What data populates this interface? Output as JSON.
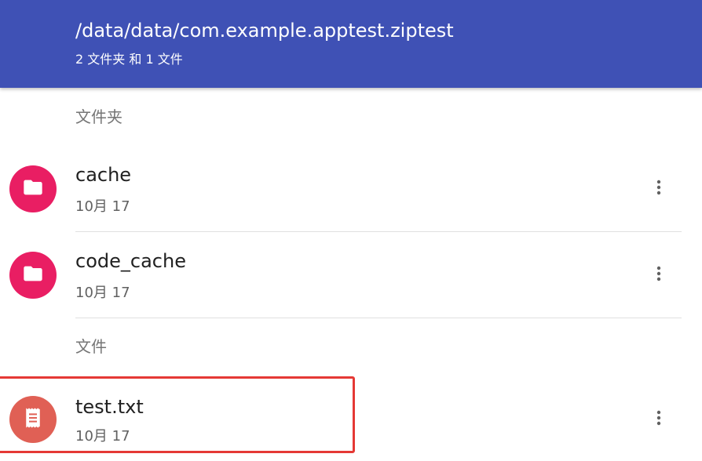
{
  "appbar": {
    "title": "/data/data/com.example.apptest.ziptest",
    "subtitle": "2 文件夹 和 1 文件",
    "color": "#3f51b5"
  },
  "sections": {
    "folders_header": "文件夹",
    "files_header": "文件"
  },
  "folders": [
    {
      "name": "cache",
      "date": "10月 17",
      "icon": "folder-icon",
      "color": "#e91e63"
    },
    {
      "name": "code_cache",
      "date": "10月 17",
      "icon": "folder-icon",
      "color": "#e91e63"
    }
  ],
  "files": [
    {
      "name": "test.txt",
      "date": "10月 17",
      "icon": "text-file-icon",
      "color": "#e06055",
      "highlighted": true
    }
  ],
  "colors": {
    "folder_avatar": "#e91e63",
    "file_avatar": "#e06055",
    "highlight_border": "#e53935"
  }
}
